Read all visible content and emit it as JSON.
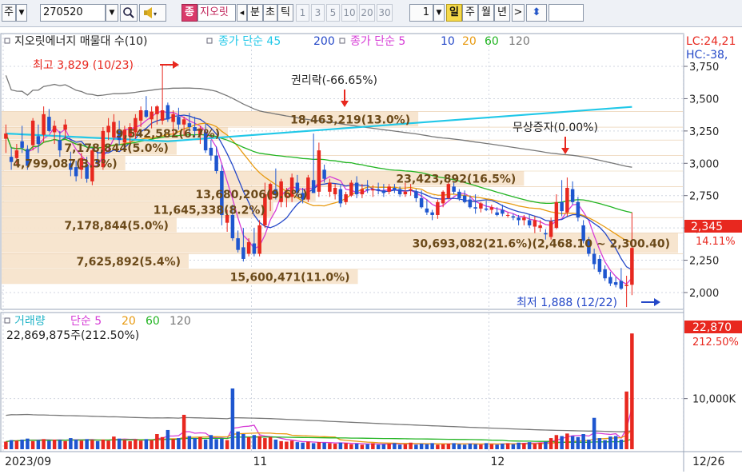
{
  "toolbar": {
    "market": "주",
    "code": "270520",
    "tag": "종",
    "stock_name": "지오릿",
    "left_arrow": "◂",
    "period_min": "분",
    "period_tick_a": "초",
    "period_tick_b": "틱",
    "intervals": [
      "1",
      "3",
      "5",
      "10",
      "20",
      "30"
    ],
    "count": "1",
    "period_day": "일",
    "period_week": "주",
    "period_month": "월",
    "period_year": "년",
    "right_arrow": ">",
    "updown": "⬍"
  },
  "colors": {
    "up": "#e8281f",
    "down": "#1e56cf",
    "ma5": "#d63cd6",
    "ma10": "#2448c8",
    "ma20": "#e89a10",
    "ma60": "#22b422",
    "ma120": "#777777",
    "ma45": "#22c8e8",
    "ma200": "#777777",
    "band": "#f7e4cc",
    "grid": "#d0d6e0"
  },
  "chart_data": [
    {
      "type": "candlestick",
      "legend_title": "지오릿에너지 매물대 수(10)",
      "legend_items": [
        {
          "text": "종가 단순 45",
          "color": "#22c8e8"
        },
        {
          "text": "200",
          "color": "#2448c8"
        },
        {
          "text": "종가 단순 5",
          "color": "#d63cd6"
        },
        {
          "text": "10",
          "color": "#2448c8"
        },
        {
          "text": "20",
          "color": "#e89a10"
        },
        {
          "text": "60",
          "color": "#22b422"
        },
        {
          "text": "120",
          "color": "#777777"
        }
      ],
      "ylim": [
        1870,
        3880
      ],
      "y_ticks": [
        "3,750",
        "3,500",
        "3,250",
        "3,000",
        "2,750",
        "2,500",
        "2,250",
        "2,000"
      ],
      "y_tick_values": [
        3750,
        3500,
        3250,
        3000,
        2750,
        2500,
        2250,
        2000
      ],
      "top_right_labels": [
        "LC:24,21",
        "HC:-38,"
      ],
      "last_price_label": "2,345",
      "last_change_label": "14.11%",
      "x_labels": [
        "2023/09",
        "11",
        "12",
        "12/26"
      ],
      "x_label_index": [
        0,
        46,
        90,
        126
      ],
      "ohlc": [
        [
          3190,
          3300,
          3080,
          3230
        ],
        [
          3050,
          3120,
          2950,
          3010
        ],
        [
          3040,
          3150,
          2980,
          3100
        ],
        [
          3170,
          3290,
          3080,
          3120
        ],
        [
          3110,
          3140,
          2950,
          2980
        ],
        [
          3140,
          3350,
          3100,
          3330
        ],
        [
          3210,
          3300,
          3080,
          3150
        ],
        [
          3220,
          3440,
          3160,
          3380
        ],
        [
          3360,
          3420,
          3240,
          3250
        ],
        [
          3240,
          3330,
          3150,
          3290
        ],
        [
          3180,
          3250,
          3050,
          3100
        ],
        [
          3260,
          3340,
          3190,
          3300
        ],
        [
          3000,
          3090,
          2900,
          2950
        ],
        [
          2970,
          3020,
          2860,
          2900
        ],
        [
          2950,
          3080,
          2880,
          3040
        ],
        [
          2990,
          3050,
          2850,
          2880
        ],
        [
          2860,
          3110,
          2830,
          3100
        ],
        [
          3030,
          3150,
          2980,
          3000
        ],
        [
          2970,
          3280,
          2950,
          3250
        ],
        [
          3240,
          3350,
          3180,
          3290
        ],
        [
          3200,
          3380,
          3180,
          3320
        ],
        [
          3250,
          3330,
          3140,
          3180
        ],
        [
          3160,
          3290,
          3110,
          3260
        ],
        [
          3210,
          3310,
          3140,
          3280
        ],
        [
          3240,
          3380,
          3190,
          3350
        ],
        [
          3330,
          3440,
          3280,
          3410
        ],
        [
          3410,
          3520,
          3350,
          3360
        ],
        [
          3340,
          3440,
          3270,
          3400
        ],
        [
          3380,
          3450,
          3300,
          3440
        ],
        [
          3330,
          3760,
          3300,
          3410
        ],
        [
          3450,
          3470,
          3320,
          3340
        ],
        [
          3320,
          3410,
          3210,
          3380
        ],
        [
          3360,
          3430,
          3260,
          3300
        ],
        [
          3300,
          3360,
          3210,
          3340
        ],
        [
          3310,
          3390,
          3240,
          3280
        ],
        [
          3280,
          3360,
          3200,
          3250
        ],
        [
          3220,
          3290,
          3150,
          3270
        ],
        [
          3240,
          3310,
          3080,
          3100
        ],
        [
          3120,
          3180,
          3020,
          3060
        ],
        [
          3060,
          3130,
          2920,
          2940
        ],
        [
          2940,
          2990,
          2520,
          2600
        ],
        [
          2540,
          2640,
          2470,
          2600
        ],
        [
          2600,
          2680,
          2400,
          2420
        ],
        [
          2420,
          2480,
          2310,
          2330
        ],
        [
          2350,
          2500,
          2240,
          2260
        ],
        [
          2300,
          2420,
          2280,
          2390
        ],
        [
          2380,
          2500,
          2280,
          2300
        ],
        [
          2300,
          2560,
          2280,
          2520
        ],
        [
          2520,
          2850,
          2500,
          2760
        ],
        [
          2720,
          2850,
          2630,
          2840
        ],
        [
          2800,
          2960,
          2720,
          2760
        ],
        [
          2700,
          2880,
          2660,
          2860
        ],
        [
          2740,
          2810,
          2660,
          2750
        ],
        [
          2740,
          2920,
          2700,
          2890
        ],
        [
          2850,
          2910,
          2740,
          2770
        ],
        [
          2770,
          2810,
          2690,
          2720
        ],
        [
          2720,
          2910,
          2700,
          2890
        ],
        [
          2870,
          3230,
          2780,
          2770
        ],
        [
          2780,
          3160,
          2740,
          3100
        ],
        [
          2950,
          2990,
          2850,
          2880
        ],
        [
          2780,
          2880,
          2740,
          2850
        ],
        [
          2760,
          2840,
          2720,
          2810
        ],
        [
          2800,
          2830,
          2660,
          2690
        ],
        [
          2700,
          2780,
          2680,
          2760
        ],
        [
          2750,
          2870,
          2740,
          2850
        ],
        [
          2850,
          2900,
          2730,
          2760
        ],
        [
          2760,
          2840,
          2730,
          2800
        ],
        [
          2800,
          2870,
          2770,
          2790
        ],
        [
          2790,
          2830,
          2740,
          2800
        ],
        [
          2800,
          2850,
          2760,
          2790
        ],
        [
          2790,
          2840,
          2740,
          2770
        ],
        [
          2780,
          2840,
          2760,
          2820
        ],
        [
          2810,
          2840,
          2770,
          2790
        ],
        [
          2800,
          2820,
          2740,
          2760
        ],
        [
          2760,
          2850,
          2740,
          2780
        ],
        [
          2790,
          2840,
          2750,
          2800
        ],
        [
          2780,
          2800,
          2700,
          2730
        ],
        [
          2730,
          2790,
          2650,
          2660
        ],
        [
          2650,
          2720,
          2600,
          2620
        ],
        [
          2620,
          2640,
          2560,
          2600
        ],
        [
          2600,
          2720,
          2570,
          2700
        ],
        [
          2690,
          2790,
          2660,
          2780
        ],
        [
          2730,
          2860,
          2720,
          2840
        ],
        [
          2820,
          2850,
          2760,
          2780
        ],
        [
          2780,
          2800,
          2710,
          2730
        ],
        [
          2750,
          2790,
          2690,
          2700
        ],
        [
          2720,
          2750,
          2650,
          2660
        ],
        [
          2660,
          2760,
          2610,
          2650
        ],
        [
          2650,
          2700,
          2620,
          2690
        ],
        [
          2650,
          2710,
          2630,
          2640
        ],
        [
          2640,
          2680,
          2610,
          2660
        ],
        [
          2620,
          2660,
          2590,
          2600
        ],
        [
          2640,
          2680,
          2590,
          2610
        ],
        [
          2600,
          2620,
          2580,
          2600
        ],
        [
          2590,
          2610,
          2560,
          2580
        ],
        [
          2580,
          2600,
          2520,
          2560
        ],
        [
          2560,
          2600,
          2520,
          2580
        ],
        [
          2560,
          2600,
          2500,
          2520
        ],
        [
          2510,
          2590,
          2460,
          2560
        ],
        [
          2500,
          2560,
          2470,
          2520
        ],
        [
          2460,
          2490,
          2410,
          2450
        ],
        [
          2430,
          2580,
          2410,
          2550
        ],
        [
          2500,
          2760,
          2490,
          2700
        ],
        [
          2700,
          2870,
          2590,
          2630
        ],
        [
          2620,
          2890,
          2590,
          2810
        ],
        [
          2800,
          2860,
          2680,
          2700
        ],
        [
          2700,
          2740,
          2550,
          2580
        ],
        [
          2520,
          2560,
          2380,
          2400
        ],
        [
          2410,
          2430,
          2280,
          2300
        ],
        [
          2300,
          2340,
          2180,
          2220
        ],
        [
          2260,
          2290,
          2140,
          2160
        ],
        [
          2180,
          2210,
          2090,
          2110
        ],
        [
          2120,
          2160,
          2050,
          2070
        ],
        [
          2080,
          2120,
          2040,
          2060
        ],
        [
          2090,
          2190,
          2020,
          2030
        ],
        [
          2050,
          2130,
          1888,
          2060
        ],
        [
          2060,
          2620,
          1980,
          2345
        ],
        [
          2345,
          2345,
          2345,
          2345
        ],
        [
          2345,
          2345,
          2345,
          2345
        ],
        [
          2345,
          2345,
          2345,
          2345
        ],
        [
          2345,
          2345,
          2345,
          2345
        ],
        [
          2345,
          2345,
          2345,
          2345
        ]
      ],
      "volume_profile": [
        {
          "label": "7,178,844(5.0%)",
          "price_low": 3060,
          "price_high": 3180,
          "share": 5.0
        },
        {
          "label": "9,542,582(6.7%)",
          "price_low": 3180,
          "price_high": 3280,
          "share": 6.7
        },
        {
          "label": "18,463,219(13.0%)",
          "price_low": 3280,
          "price_high": 3400,
          "share": 13.0
        },
        {
          "label": "4,799,087(3.3%)",
          "price_low": 2940,
          "price_high": 3060,
          "share": 3.3
        },
        {
          "label": "23,423,892(16.5%)",
          "price_low": 2820,
          "price_high": 2940,
          "share": 16.5
        },
        {
          "label": "13,680,206(9.6%)",
          "price_low": 2700,
          "price_high": 2820,
          "share": 9.6
        },
        {
          "label": "11,645,338(8.2%)",
          "price_low": 2580,
          "price_high": 2700,
          "share": 8.2
        },
        {
          "label": "7,178,844(5.0%)",
          "price_low": 2460,
          "price_high": 2580,
          "share": 5.0
        },
        {
          "label": "30,693,082(21.6%)(2,468.10 ~ 2,300.40)",
          "price_low": 2300,
          "price_high": 2460,
          "share": 21.6
        },
        {
          "label": "7,625,892(5.4%)",
          "price_low": 2180,
          "price_high": 2300,
          "share": 5.4
        },
        {
          "label": "15,600,471(11.0%)",
          "price_low": 2060,
          "price_high": 2180,
          "share": 11.0
        }
      ],
      "annotations": [
        {
          "text": "최고 3,829 (10/23)",
          "price": 3829
        },
        {
          "text": "권리락(-66.65%)",
          "price": 3420
        },
        {
          "text": "무상증자(0.00%)",
          "price": 2910
        },
        {
          "text": "최저 1,888 (12/22)",
          "price": 1888
        }
      ]
    },
    {
      "type": "bar",
      "legend_title": "거래량",
      "legend_items": [
        {
          "text": "단순 5",
          "color": "#d63cd6"
        },
        {
          "text": "20",
          "color": "#e89a10"
        },
        {
          "text": "60",
          "color": "#22b422"
        },
        {
          "text": "120",
          "color": "#777777"
        }
      ],
      "current_label": "22,869,875주(212.50%)",
      "ylim": [
        0,
        24000000
      ],
      "y_ticks": [
        "10,000K"
      ],
      "y_tick_values": [
        10000000
      ],
      "last_value_label": "22,870",
      "last_change_label": "212.50%",
      "volumes": [
        1500000,
        1800000,
        1700000,
        1900000,
        2100000,
        1600000,
        1800000,
        2000000,
        1700000,
        1900000,
        1800000,
        1600000,
        2200000,
        1900000,
        1700000,
        2000000,
        1800000,
        1600000,
        1900000,
        1700000,
        2500000,
        2100000,
        1800000,
        1600000,
        1900000,
        1700000,
        2000000,
        1800000,
        3000000,
        2400000,
        3800000,
        2000000,
        2200000,
        6800000,
        2600000,
        2200000,
        2400000,
        1900000,
        2800000,
        2000000,
        2100000,
        1800000,
        12000000,
        3500000,
        3000000,
        2400000,
        2800000,
        2600000,
        2200000,
        2400000,
        1900000,
        1600000,
        1500000,
        1700000,
        1400000,
        1300000,
        1500000,
        1200000,
        1400000,
        1300000,
        1200000,
        1100000,
        1300000,
        1200000,
        1000000,
        1100000,
        900000,
        1000000,
        1200000,
        900000,
        1000000,
        1100000,
        1200000,
        900000,
        1000000,
        1300000,
        900000,
        1100000,
        1000000,
        1200000,
        900000,
        1000000,
        1100000,
        1200000,
        1000000,
        900000,
        1100000,
        1000000,
        900000,
        1200000,
        1000000,
        900000,
        1100000,
        1200000,
        1000000,
        1300000,
        1200000,
        1400000,
        1100000,
        1300000,
        1500000,
        2200000,
        2800000,
        2600000,
        3100000,
        2600000,
        2400000,
        3000000,
        1900000,
        6200000,
        2200000,
        1800000,
        2500000,
        2600000,
        1900000,
        11400000,
        22869875,
        0,
        0,
        0,
        0,
        0
      ]
    }
  ]
}
